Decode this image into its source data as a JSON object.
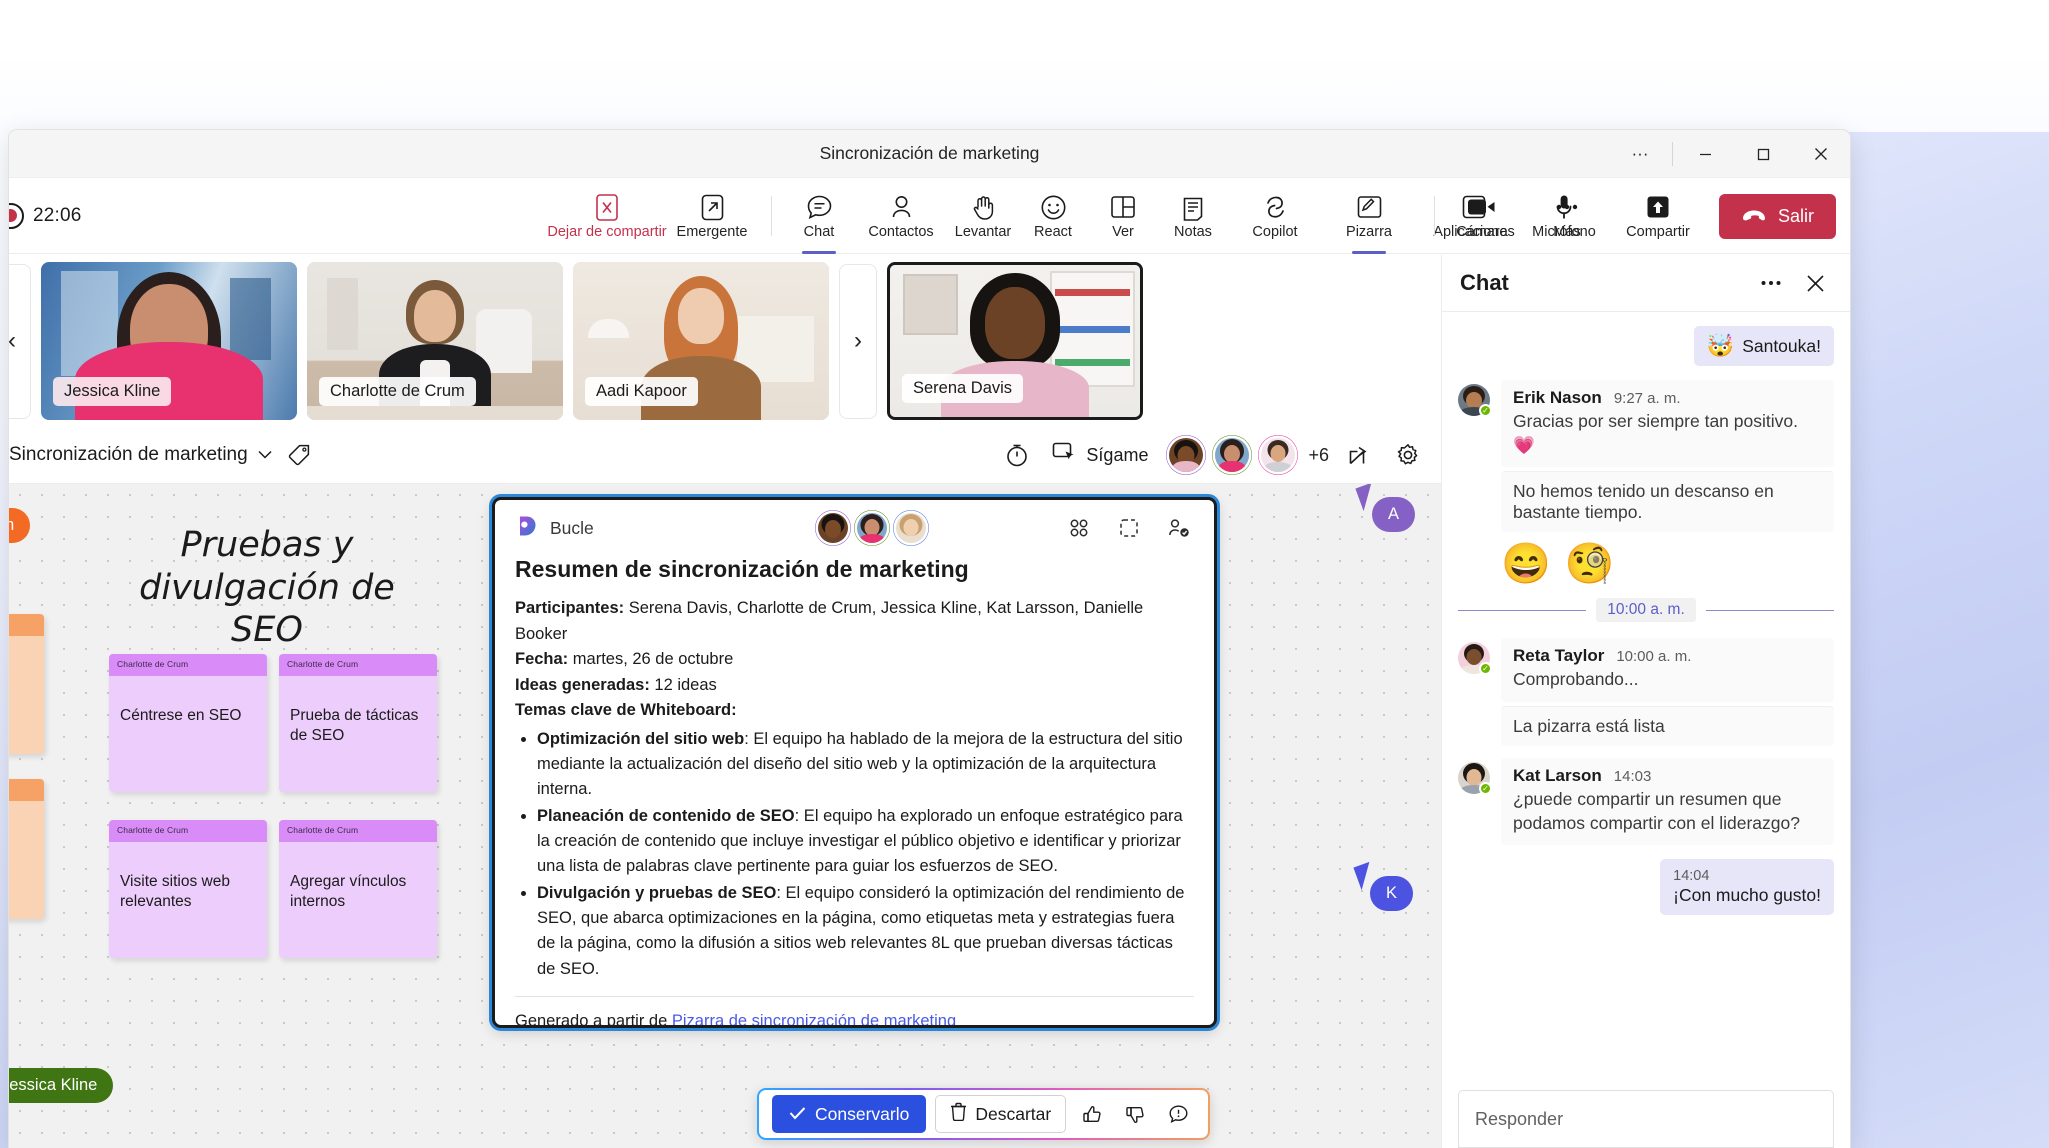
{
  "window": {
    "title": "Sincronización de marketing",
    "controls": {
      "more": "···",
      "minimize": "─",
      "maximize": "▢",
      "close": "✕"
    }
  },
  "meeting_toolbar": {
    "recording_time": "22:06",
    "left_items": [
      {
        "name": "stop-sharing",
        "label": "Dejar de compartir",
        "icon": "stop-share-icon",
        "accent": "#c4314b"
      },
      {
        "name": "popout",
        "label": "Emergente",
        "icon": "popout-icon"
      }
    ],
    "items": [
      {
        "name": "chat",
        "label": "Chat",
        "icon": "chat-icon",
        "active": true
      },
      {
        "name": "people",
        "label": "Contactos",
        "icon": "people-icon",
        "active": false
      },
      {
        "name": "raise-hand",
        "label": "Levantar",
        "icon": "hand-icon",
        "active": false
      },
      {
        "name": "react",
        "label": "React",
        "icon": "smiley-icon",
        "active": false
      },
      {
        "name": "view",
        "label": "Ver",
        "icon": "layout-icon",
        "active": false
      },
      {
        "name": "notes",
        "label": "Notas",
        "icon": "notes-icon",
        "active": false
      },
      {
        "name": "copilot",
        "label": "Copilot",
        "icon": "copilot-icon",
        "active": false
      },
      {
        "name": "whiteboard",
        "label": "Pizarra",
        "icon": "whiteboard-icon",
        "active": true
      },
      {
        "name": "apps",
        "label": "Aplicaciones",
        "icon": "plus-square-icon",
        "active": false
      },
      {
        "name": "more",
        "label": "Más",
        "icon": "ellipsis-icon",
        "active": false
      }
    ],
    "device_items": [
      {
        "name": "camera",
        "label": "Cámara",
        "icon": "camera-icon"
      },
      {
        "name": "microphone",
        "label": "Micrófono",
        "icon": "microphone-icon"
      },
      {
        "name": "share",
        "label": "Compartir",
        "icon": "share-screen-icon"
      }
    ],
    "leave_label": "Salir",
    "leave_color": "#c4314b"
  },
  "filmstrip": {
    "prev_label": "‹",
    "next_label": "›",
    "tiles": [
      {
        "name": "Jessica Kline",
        "speaking": false
      },
      {
        "name": "Charlotte de Crum",
        "speaking": false
      },
      {
        "name": "Aadi Kapoor",
        "speaking": false
      },
      {
        "name": "Serena Davis",
        "speaking": true
      }
    ]
  },
  "whiteboard_bar": {
    "title": "Sincronización de marketing",
    "chevron": "⌄",
    "tag_icon": "tag-icon",
    "timer_icon": "timer-icon",
    "follow_label": "Sígame",
    "overflow_count": "+6",
    "share_icon": "share-icon",
    "settings_icon": "gear-icon"
  },
  "canvas": {
    "heading_line1": "Pruebas y",
    "heading_line2": "divulgación de SEO",
    "notes": [
      {
        "author": "Charlotte de Crum",
        "text": "Céntrese en SEO",
        "color": "purple"
      },
      {
        "author": "Charlotte de Crum",
        "text": "Prueba de tácticas de SEO",
        "color": "purple"
      },
      {
        "author": "Charlotte de Crum",
        "text": "Visite sitios web relevantes",
        "color": "purple"
      },
      {
        "author": "Charlotte de Crum",
        "text": "Agregar vínculos internos",
        "color": "purple"
      }
    ],
    "cursors": [
      {
        "label": "de Crum",
        "color": "#f26a23"
      },
      {
        "label": "Jessica Kline",
        "color": "#3f7512"
      },
      {
        "label": "A",
        "color": "#8561c5"
      },
      {
        "label": "K",
        "color": "#4b53e0"
      }
    ]
  },
  "loop_card": {
    "app_name": "Bucle",
    "app_icon": "loop-icon",
    "header_icons": [
      "grid-icon",
      "dashed-frame-icon",
      "people-check-icon"
    ],
    "heading": "Resumen de sincronización de marketing",
    "fields": [
      {
        "label": "Participantes:",
        "value": " Serena Davis, Charlotte de Crum, Jessica Kline, Kat Larsson, Danielle Booker"
      },
      {
        "label": "Fecha:",
        "value": " martes, 26 de octubre"
      },
      {
        "label": "Ideas generadas:",
        "value": " 12 ideas"
      },
      {
        "label": "Temas clave de Whiteboard:",
        "value": ""
      }
    ],
    "bullets": [
      {
        "title": "Optimización del sitio web",
        "text": ": El equipo ha hablado de la mejora de la estructura del sitio mediante la actualización del diseño del sitio web y la optimización de la arquitectura interna."
      },
      {
        "title": "Planeación de contenido de SEO",
        "text": ": El equipo ha explorado un enfoque estratégico para la creación de contenido que incluye investigar el público objetivo e identificar y priorizar una lista de palabras clave pertinente para guiar los esfuerzos de SEO."
      },
      {
        "title": "Divulgación y pruebas de SEO",
        "text": ": El equipo consideró la optimización del rendimiento de SEO, que abarca optimizaciones en la página, como etiquetas meta y estrategias fuera de la página, como la difusión a sitios web relevantes 8L que prueban diversas tácticas de SEO."
      }
    ],
    "footer_prefix": "Generado a partir de ",
    "footer_link": "Pizarra de sincronización de marketing"
  },
  "keep_discard_bar": {
    "keep_label": "Conservarlo",
    "keep_icon": "check-icon",
    "keep_color": "#2b50e0",
    "discard_label": "Descartar",
    "discard_icon": "trash-icon",
    "thumbs_up_icon": "thumbs-up-icon",
    "thumbs_down_icon": "thumbs-down-icon",
    "feedback_icon": "comment-icon"
  },
  "chat": {
    "title": "Chat",
    "more_icon": "ellipsis-icon",
    "close_icon": "close-icon",
    "outgoing_top": {
      "emoji": "🤯",
      "text": "Santouka!"
    },
    "messages": [
      {
        "author": "Erik Nason",
        "time": "9:27 a. m.",
        "body": "Gracias por ser siempre tan positivo. ",
        "body_emoji": "💗",
        "continuation": "No hemos tenido un descanso en bastante tiempo.",
        "reactions": [
          "😄",
          "🧐"
        ]
      },
      {
        "author": "Reta Taylor",
        "time": "10:00 a. m.",
        "body": "Comprobando...",
        "continuation": "La pizarra está lista"
      },
      {
        "author": "Kat Larson",
        "time": "14:03",
        "body": "¿puede compartir un resumen que podamos compartir con el liderazgo?"
      }
    ],
    "day_divider": "10:00 a. m.",
    "outgoing_bottom": {
      "time": "14:04",
      "text": "¡Con mucho gusto!"
    },
    "composer_placeholder": "Responder"
  }
}
